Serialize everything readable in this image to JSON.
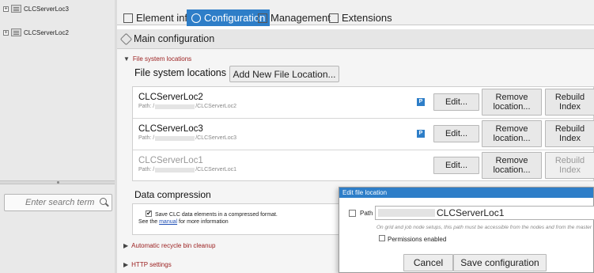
{
  "tree": {
    "items": [
      {
        "label": "CLCServerLoc3",
        "expand": "+"
      },
      {
        "label": "CLCServerLoc2",
        "expand": "+"
      }
    ]
  },
  "search": {
    "placeholder": "Enter search term"
  },
  "tabs": [
    {
      "label": "Element info",
      "icon": "document-icon"
    },
    {
      "label": "Configuration",
      "icon": "gear-icon",
      "active": true
    },
    {
      "label": "Management",
      "icon": "management-icon"
    },
    {
      "label": "Extensions",
      "icon": "plugin-icon"
    }
  ],
  "main": {
    "title": "Main configuration"
  },
  "file_system": {
    "toggle": "File system locations",
    "heading": "File system locations",
    "add_button": "Add New File Location...",
    "locations": [
      {
        "name": "CLCServerLoc2",
        "path_prefix": "Path: /",
        "path_suffix": "/CLCServerLoc2",
        "badge": "P",
        "edit": "Edit...",
        "remove": "Remove location...",
        "rebuild": "Rebuild Index",
        "disabled": false
      },
      {
        "name": "CLCServerLoc3",
        "path_prefix": "Path: /",
        "path_suffix": "/CLCServerLoc3",
        "badge": "P",
        "edit": "Edit...",
        "remove": "Remove location...",
        "rebuild": "Rebuild Index",
        "disabled": false
      },
      {
        "name": "CLCServerLoc1",
        "path_prefix": "Path: /",
        "path_suffix": "/CLCServerLoc1",
        "badge": "",
        "edit": "Edit...",
        "remove": "Remove location...",
        "rebuild": "Rebuild Index",
        "disabled": true
      }
    ]
  },
  "data_compression": {
    "heading": "Data compression",
    "checkbox_label": "Save CLC data elements in a compressed format.",
    "see_prefix": "See the",
    "link": "manual",
    "see_suffix": "for more information"
  },
  "sections": {
    "recycle": "Automatic recycle bin cleanup",
    "http": "HTTP settings"
  },
  "dialog": {
    "title": "Edit file location",
    "path_label": "Path",
    "path_value": "CLCServerLoc1",
    "hint": "On grid and job node setups, this path must be accessible from the nodes and from the master",
    "permissions_label": "Permissions enabled",
    "cancel": "Cancel",
    "save": "Save configuration"
  },
  "colors": {
    "accent": "#2e7ec8",
    "toggle_red": "#9a1d1d"
  }
}
